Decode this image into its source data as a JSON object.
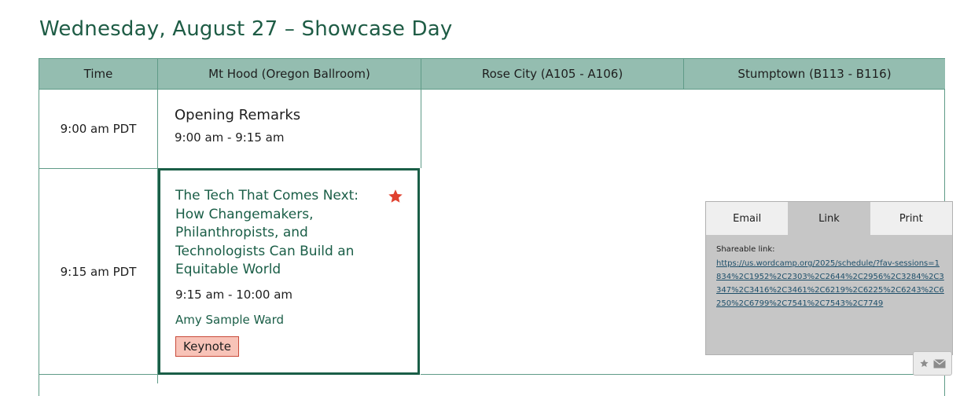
{
  "page": {
    "title": "Wednesday, August 27 – Showcase Day"
  },
  "table": {
    "headers": [
      "Time",
      "Mt Hood (Oregon Ballroom)",
      "Rose City (A105 - A106)",
      "Stumptown (B113 - B116)"
    ],
    "rows": [
      {
        "time": "9:00 am PDT"
      },
      {
        "time": "9:15 am PDT"
      }
    ]
  },
  "sessions": [
    {
      "title": "Opening Remarks",
      "time": "9:00 am - 9:15 am"
    },
    {
      "title": "The Tech That Comes Next: How Changemakers, Philanthropists, and Technologists Can Build an Equitable World",
      "time": "9:15 am - 10:00 am",
      "speaker": "Amy Sample Ward",
      "tag": "Keynote",
      "favorited": true
    }
  ],
  "share_panel": {
    "tabs": [
      "Email",
      "Link",
      "Print"
    ],
    "active_tab": "Link",
    "label": "Shareable link:",
    "url": "https://us.wordcamp.org/2025/schedule/?fav-sessions=1834%2C1952%2C2303%2C2644%2C2956%2C3284%2C3347%2C3416%2C3461%2C6219%2C6225%2C6243%2C6250%2C6799%2C7541%2C7543%2C7749"
  },
  "icons": {
    "favorite": "star-icon",
    "share": "envelope-icon"
  },
  "colors": {
    "heading_green": "#1e5c45",
    "header_bg": "#94bdb0",
    "grid_line": "#5f9b87",
    "star": "#e0412f",
    "tag_bg": "#f8c3b8"
  }
}
